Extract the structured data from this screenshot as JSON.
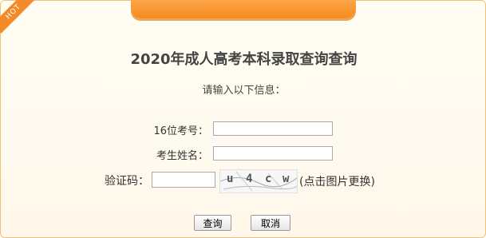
{
  "badge": {
    "label": "HOT"
  },
  "heading": {
    "title": "2020年成人高考本科录取查询查询"
  },
  "form": {
    "instruction": "请输入以下信息：",
    "exam_no_label": "16位考号：",
    "name_label": "考生姓名：",
    "captcha_label": "验证码：",
    "captcha_chars": [
      "u",
      "4",
      "c",
      "w"
    ],
    "captcha_hint": "(点击图片更换)"
  },
  "buttons": {
    "submit": "查询",
    "cancel": "取消"
  },
  "colors": {
    "accent": "#f68a1e",
    "border": "#f2c27a"
  }
}
